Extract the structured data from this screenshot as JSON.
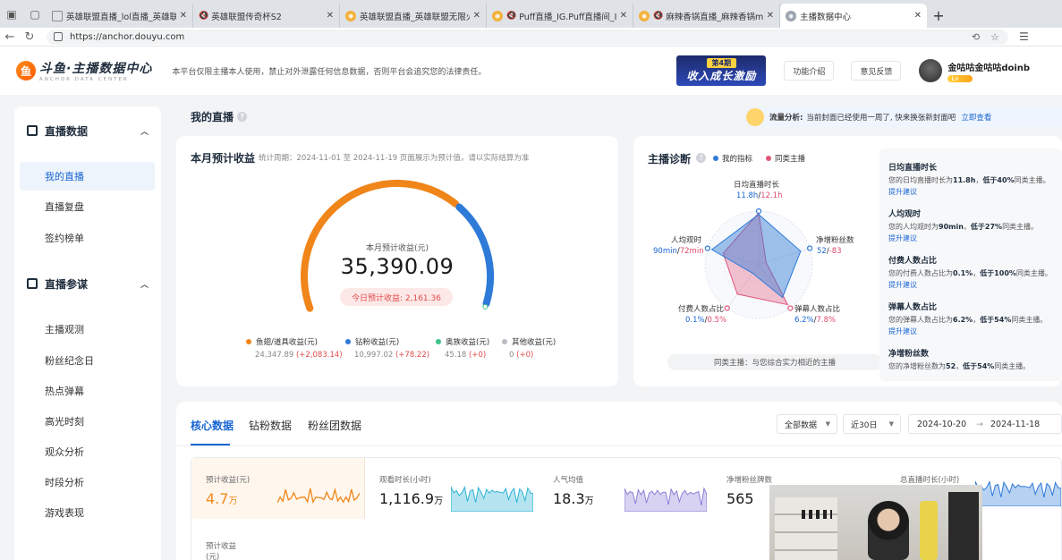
{
  "browser": {
    "tabs": [
      {
        "label": "英雄联盟直播_lol直播_英雄联盟",
        "muted": false
      },
      {
        "label": "英雄联盟传奇杯S2",
        "muted": true
      },
      {
        "label": "英雄联盟直播_英雄联盟无限火力",
        "muted": false
      },
      {
        "label": "Puff直播_IG.Puff直播间_IG",
        "muted": true
      },
      {
        "label": "麻辣香锅直播_麻辣香锅mlxg",
        "muted": true
      },
      {
        "label": "主播数据中心",
        "muted": false
      }
    ],
    "url": "https://anchor.douyu.com"
  },
  "header": {
    "logo_main": "斗鱼·主播数据中心",
    "logo_sub": "ANCHOR DATA CENTER",
    "notice": "本平台仅限主播本人使用，禁止对外泄露任何信息数据，否则平台会追究您的法律责任。",
    "banner_top": "第4期",
    "banner_bottom": "收入成长激励",
    "btn_intro": "功能介绍",
    "btn_feedback": "意见反馈",
    "username": "金咕咕金咕咕doinb",
    "level": "Lv"
  },
  "sidebar": {
    "group1": "直播数据",
    "group1_items": [
      "我的直播",
      "直播复盘",
      "签约榜单"
    ],
    "group2": "直播参谋",
    "group2_items": [
      "主播观测",
      "粉丝纪念日",
      "热点弹幕",
      "高光时刻",
      "观众分析",
      "时段分析",
      "游戏表现"
    ]
  },
  "page": {
    "title": "我的直播",
    "traffic_label": "流量分析:",
    "traffic_text": "当前封面已经使用一周了, 快来换张新封面吧",
    "traffic_link": "立即查看"
  },
  "earnings": {
    "title": "本月预计收益",
    "period": "统计周期：2024-11-01 至 2024-11-19 页面展示为预计值，请以实际结算为准",
    "gauge_label": "本月预计收益(元)",
    "total": "35,390.09",
    "today": "今日预计收益: 2,161.36",
    "gauge_shares": [
      0.69,
      0.31,
      0.001,
      0.0
    ],
    "legend": [
      {
        "name": "鱼翅/道具收益(元)",
        "value": "24,347.89",
        "delta": "(+2,083.14)",
        "color": "#f0851a"
      },
      {
        "name": "钻粉收益(元)",
        "value": "10,997.02",
        "delta": "(+78.22)",
        "color": "#2e7ad8"
      },
      {
        "name": "奥族收益(元)",
        "value": "45.18",
        "delta": "(+0)",
        "color": "#3fc28a"
      },
      {
        "name": "其他收益(元)",
        "value": "0",
        "delta": "(+0)",
        "color": "#b8bcc3"
      }
    ]
  },
  "diagnosis": {
    "title": "主播诊断",
    "legend_mine": "我的指标",
    "legend_peer": "同类主播",
    "color_mine": "#2e7ad8",
    "color_peer": "#e1567a",
    "axes": [
      {
        "name": "日均直播时长",
        "mine": "11.8h",
        "peer": "12.1h",
        "mine_ratio": 0.97,
        "peer_ratio": 1.0
      },
      {
        "name": "净增粉丝数",
        "mine": "52",
        "peer": "-83",
        "mine_ratio": 0.85,
        "peer_ratio": 0.15
      },
      {
        "name": "弹幕人数占比",
        "mine": "6.2%",
        "peer": "7.8%",
        "mine_ratio": 0.78,
        "peer_ratio": 0.95
      },
      {
        "name": "付费人数占比",
        "mine": "0.1%",
        "peer": "0.5%",
        "mine_ratio": 0.2,
        "peer_ratio": 0.7
      },
      {
        "name": "人均观时",
        "mine": "90min",
        "peer": "72min",
        "mine_ratio": 0.95,
        "peer_ratio": 0.72
      }
    ],
    "footer": "同类主播：与您综合实力相近的主播",
    "advice": [
      {
        "title": "日均直播时长",
        "text_pre": "您的日均直播时长为",
        "value": "11.8h",
        "text_mid": "，",
        "compare": "低于40%",
        "text_post": "同类主播。",
        "link": "提升建议"
      },
      {
        "title": "人均观时",
        "text_pre": "您的人均观时为",
        "value": "90min",
        "text_mid": "，",
        "compare": "低于27%",
        "text_post": "同类主播。",
        "link": "提升建议"
      },
      {
        "title": "付费人数占比",
        "text_pre": "您的付费人数占比为",
        "value": "0.1%",
        "text_mid": "，",
        "compare": "低于100%",
        "text_post": "同类主播。",
        "link": "提升建议"
      },
      {
        "title": "弹幕人数占比",
        "text_pre": "您的弹幕人数占比为",
        "value": "6.2%",
        "text_mid": "，",
        "compare": "低于54%",
        "text_post": "同类主播。",
        "link": "提升建议"
      },
      {
        "title": "净增粉丝数",
        "text_pre": "您的净增粉丝数为",
        "value": "52",
        "text_mid": "，",
        "compare": "低于54%",
        "text_post": "同类主播。",
        "link": ""
      }
    ]
  },
  "bottom": {
    "tabs": [
      "核心数据",
      "钻粉数据",
      "粉丝团数据"
    ],
    "filter_all": "全部数据",
    "filter_range": "近30日",
    "date_start": "2024-10-20",
    "date_arrow": "→",
    "date_end": "2024-11-18",
    "metrics": [
      {
        "label": "预计收益(元)",
        "value": "4.7",
        "unit": "万",
        "color": "#f0851a"
      },
      {
        "label": "观看时长(小时)",
        "value": "1,116.9",
        "unit": "万",
        "color": "#2bb3d4"
      },
      {
        "label": "人气均值",
        "value": "18.3",
        "unit": "万",
        "color": "#8b7fd6"
      },
      {
        "label": "净增粉丝牌数",
        "value": "565",
        "unit": "",
        "color": "#2bb3d4"
      },
      {
        "label": "总直播时长(小时)",
        "value": "",
        "unit": "",
        "color": "#2e7ad8"
      }
    ],
    "second_row_label": "预计收益(元)"
  }
}
